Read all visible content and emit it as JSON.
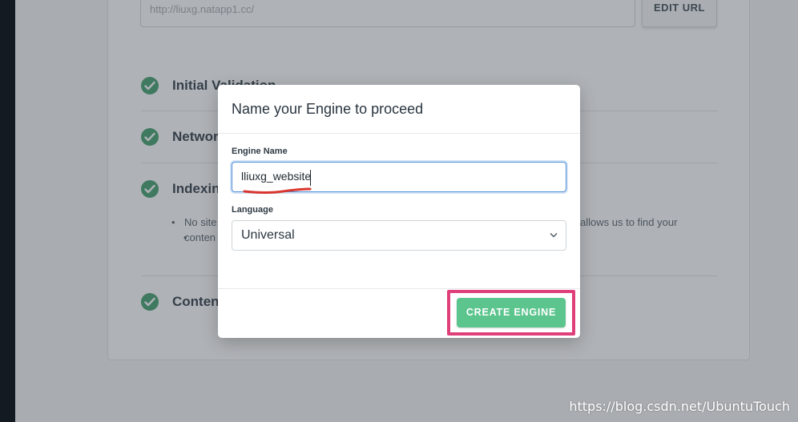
{
  "background": {
    "url_placeholder": "http://liuxg.natapp1.cc/",
    "edit_url_label": "EDIT URL",
    "steps": [
      {
        "label": "Initial Validation"
      },
      {
        "label": "Network"
      },
      {
        "label": "Indexing"
      },
      {
        "label": "Content"
      }
    ],
    "indexing_note_line1": "No site",
    "indexing_note_line2": "conten",
    "indexing_note_right": "allows us to find your"
  },
  "modal": {
    "title": "Name your Engine to proceed",
    "engine_name_label": "Engine Name",
    "engine_name_value": "lliuxg_website",
    "language_label": "Language",
    "language_value": "Universal",
    "create_button_label": "CREATE ENGINE"
  },
  "colors": {
    "accent_green": "#5cc58e",
    "check_green": "#3f9f6b",
    "highlight_pink": "#e0407a",
    "focus_blue": "#4f8fd8"
  },
  "icons": {
    "step_icon": "check-circle-icon",
    "select_icon": "chevron-down-icon"
  },
  "watermark": "https://blog.csdn.net/UbuntuTouch"
}
